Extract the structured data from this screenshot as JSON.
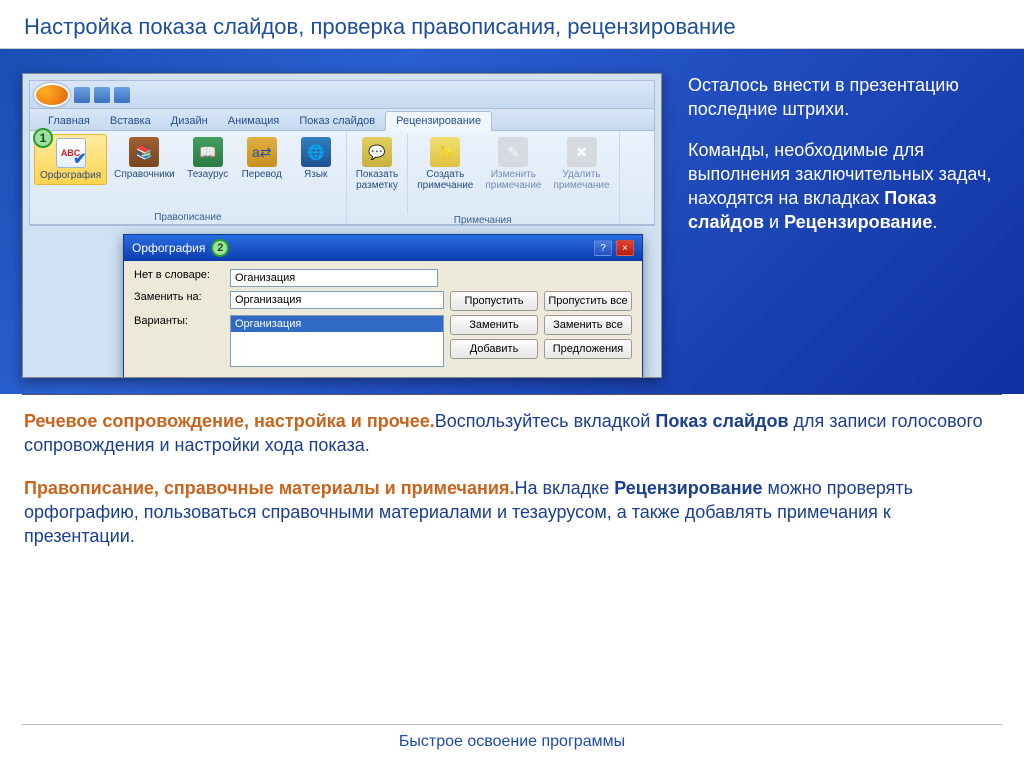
{
  "title": "Настройка показа слайдов, проверка правописания, рецензирование",
  "tabs": {
    "home": "Главная",
    "insert": "Вставка",
    "design": "Дизайн",
    "anim": "Анимация",
    "slideshow": "Показ слайдов",
    "review": "Рецензирование"
  },
  "ribbon": {
    "spelling": "Орфография",
    "research": "Справочники",
    "thesaurus": "Тезаурус",
    "translate": "Перевод",
    "language": "Язык",
    "group1": "Правописание",
    "show_markup": "Показать\nразметку",
    "new_comment": "Создать\nпримечание",
    "edit_comment": "Изменить\nпримечание",
    "delete_comment": "Удалить\nпримечание",
    "group2": "Примечания",
    "abc": "ABC"
  },
  "dialog": {
    "title": "Орфография",
    "not_in_dict": "Нет в словаре:",
    "not_in_dict_value": "Оганизация",
    "change_to": "Заменить на:",
    "change_to_value": "Организация",
    "suggestions": "Варианты:",
    "suggestion1": "Организация",
    "btn_ignore": "Пропустить",
    "btn_ignore_all": "Пропустить все",
    "btn_change": "Заменить",
    "btn_change_all": "Заменить все",
    "btn_add": "Добавить",
    "btn_suggest": "Предложения"
  },
  "callouts": {
    "c1": "1",
    "c2": "2"
  },
  "side": {
    "p1": "Осталось внести в презентацию последние штрихи.",
    "p2a": "Команды, необходимые для выполнения заключительных задач, находятся на вкладках ",
    "p2b": "Показ слайдов",
    "p2c": " и ",
    "p2d": "Рецензирование",
    "p2e": "."
  },
  "body": {
    "h1": "Речевое сопровождение, настройка и прочее.",
    "p1a": "Воспользуйтесь вкладкой ",
    "p1b": "Показ слайдов",
    "p1c": " для записи голосового сопровождения и настройки хода показа.",
    "h2": "Правописание, справочные материалы и примечания.",
    "p2a": "На вкладке ",
    "p2b": "Рецензирование",
    "p2c": " можно проверять орфографию, пользоваться справочными материалами и тезаурусом, а также добавлять примечания к презентации."
  },
  "footer": "Быстрое освоение программы"
}
